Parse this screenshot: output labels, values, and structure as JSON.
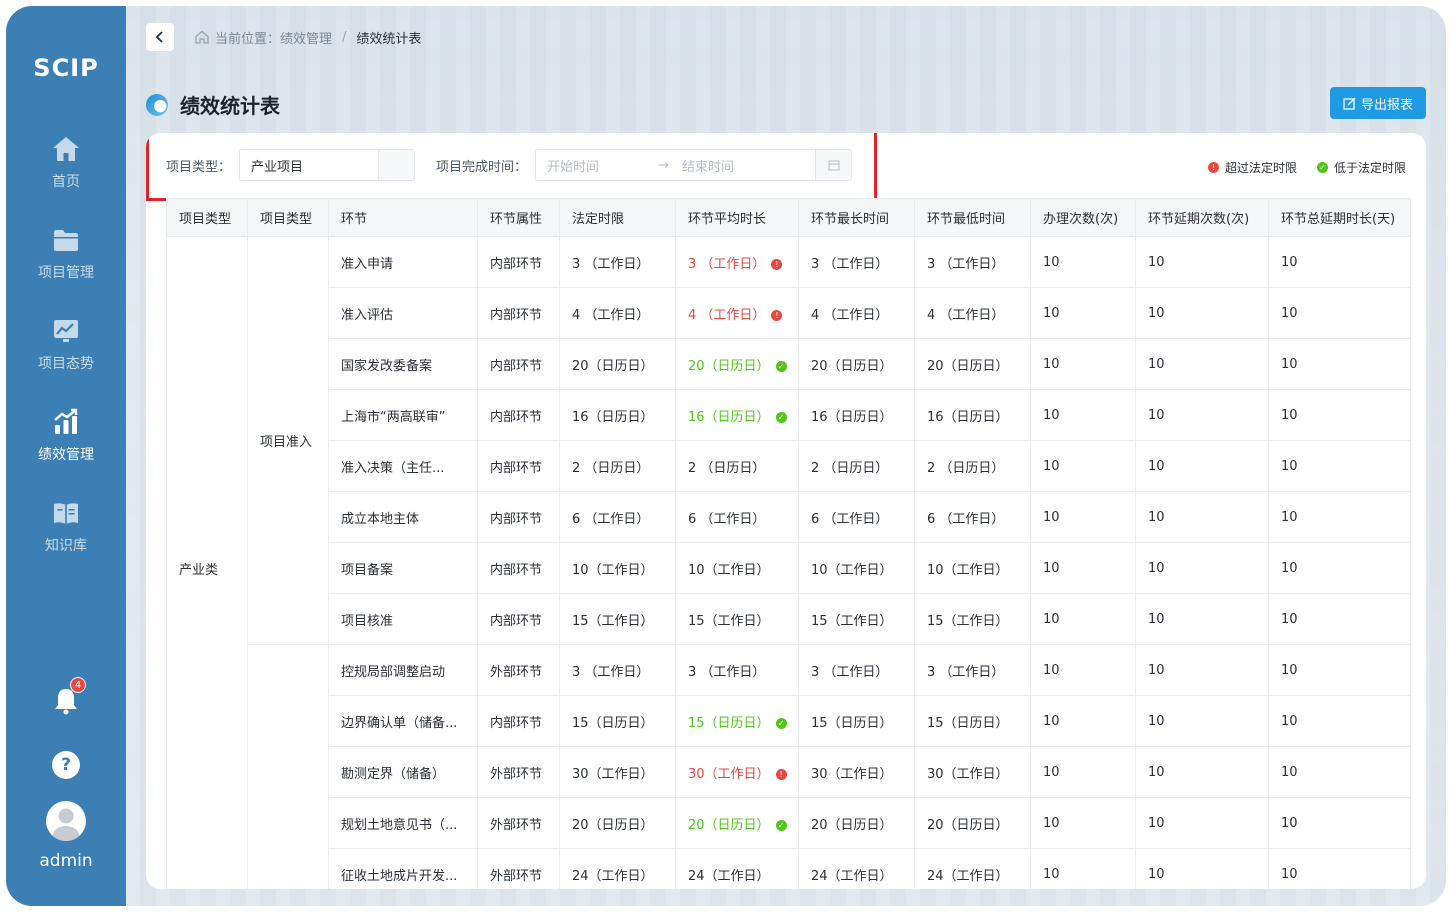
{
  "app": {
    "logo": "SCIP"
  },
  "sidebar": {
    "items": [
      {
        "label": "首页",
        "icon": "home-icon",
        "active": false
      },
      {
        "label": "项目管理",
        "icon": "folder-icon",
        "active": false
      },
      {
        "label": "项目态势",
        "icon": "trend-chart-icon",
        "active": false
      },
      {
        "label": "绩效管理",
        "icon": "bar-chart-icon",
        "active": true
      },
      {
        "label": "知识库",
        "icon": "book-icon",
        "active": false
      }
    ],
    "notification_count": "4",
    "help": "?",
    "user": "admin"
  },
  "breadcrumb": {
    "prefix": "当前位置：",
    "parent": "绩效管理",
    "sep": "/",
    "current": "绩效统计表"
  },
  "page": {
    "title": "绩效统计表",
    "export_label": "导出报表"
  },
  "filters": {
    "type_label": "项目类型：",
    "type_value": "产业项目",
    "time_label": "项目完成时间：",
    "start_placeholder": "开始时间",
    "to": "→",
    "end_placeholder": "结束时间"
  },
  "legend": {
    "over": "超过法定时限",
    "under": "低于法定时限"
  },
  "colors": {
    "accent": "#1e9be3",
    "sidebar": "#3b7fb4",
    "over": "#e8483f",
    "under": "#52c41a"
  },
  "table": {
    "headers": [
      "项目类型",
      "项目类型",
      "环节",
      "环节属性",
      "法定时限",
      "环节平均时长",
      "环节最长时间",
      "环节最低时间",
      "办理次数(次)",
      "环节延期次数(次)",
      "环节总延期时长(天)"
    ],
    "group1": "产业类",
    "group2": "项目准入",
    "rows": [
      {
        "step": "准入申请",
        "attr": "内部环节",
        "legal": "3 （工作日）",
        "avg": "3 （工作日）",
        "status": "over",
        "max": "3 （工作日）",
        "min": "3 （工作日）",
        "count": "10",
        "delays": "10",
        "delay_days": "10"
      },
      {
        "step": "准入评估",
        "attr": "内部环节",
        "legal": "4 （工作日）",
        "avg": "4 （工作日）",
        "status": "over",
        "max": "4 （工作日）",
        "min": "4 （工作日）",
        "count": "10",
        "delays": "10",
        "delay_days": "10"
      },
      {
        "step": "国家发改委备案",
        "attr": "内部环节",
        "legal": "20（日历日）",
        "avg": "20（日历日）",
        "status": "under",
        "max": "20（日历日）",
        "min": "20（日历日）",
        "count": "10",
        "delays": "10",
        "delay_days": "10"
      },
      {
        "step": "上海市“两高联审”",
        "attr": "内部环节",
        "legal": "16（日历日）",
        "avg": "16（日历日）",
        "status": "under",
        "max": "16（日历日）",
        "min": "16（日历日）",
        "count": "10",
        "delays": "10",
        "delay_days": "10"
      },
      {
        "step": "准入决策（主任...",
        "attr": "内部环节",
        "legal": "2 （日历日）",
        "avg": "2 （日历日）",
        "status": "",
        "max": "2 （日历日）",
        "min": "2 （日历日）",
        "count": "10",
        "delays": "10",
        "delay_days": "10"
      },
      {
        "step": "成立本地主体",
        "attr": "内部环节",
        "legal": "6 （工作日）",
        "avg": "6 （工作日）",
        "status": "",
        "max": "6 （工作日）",
        "min": "6 （工作日）",
        "count": "10",
        "delays": "10",
        "delay_days": "10"
      },
      {
        "step": "项目备案",
        "attr": "内部环节",
        "legal": "10（工作日）",
        "avg": "10（工作日）",
        "status": "",
        "max": "10（工作日）",
        "min": "10（工作日）",
        "count": "10",
        "delays": "10",
        "delay_days": "10"
      },
      {
        "step": "项目核准",
        "attr": "内部环节",
        "legal": "15（工作日）",
        "avg": "15（工作日）",
        "status": "",
        "max": "15（工作日）",
        "min": "15（工作日）",
        "count": "10",
        "delays": "10",
        "delay_days": "10"
      },
      {
        "step": "控规局部调整启动",
        "attr": "外部环节",
        "legal": "3 （工作日）",
        "avg": "3 （工作日）",
        "status": "",
        "max": "3 （工作日）",
        "min": "3 （工作日）",
        "count": "10",
        "delays": "10",
        "delay_days": "10"
      },
      {
        "step": "边界确认单（储备...",
        "attr": "内部环节",
        "legal": "15（日历日）",
        "avg": "15（日历日）",
        "status": "under",
        "max": "15（日历日）",
        "min": "15（日历日）",
        "count": "10",
        "delays": "10",
        "delay_days": "10"
      },
      {
        "step": "勘测定界（储备）",
        "attr": "外部环节",
        "legal": "30（工作日）",
        "avg": "30（工作日）",
        "status": "over",
        "max": "30（工作日）",
        "min": "30（工作日）",
        "count": "10",
        "delays": "10",
        "delay_days": "10"
      },
      {
        "step": "规划土地意见书（...",
        "attr": "外部环节",
        "legal": "20（日历日）",
        "avg": "20（日历日）",
        "status": "under",
        "max": "20（日历日）",
        "min": "20（日历日）",
        "count": "10",
        "delays": "10",
        "delay_days": "10"
      },
      {
        "step": "征收土地成片开发...",
        "attr": "外部环节",
        "legal": "24（工作日）",
        "avg": "24（工作日）",
        "status": "",
        "max": "24（工作日）",
        "min": "24（工作日）",
        "count": "10",
        "delays": "10",
        "delay_days": "10"
      }
    ]
  }
}
